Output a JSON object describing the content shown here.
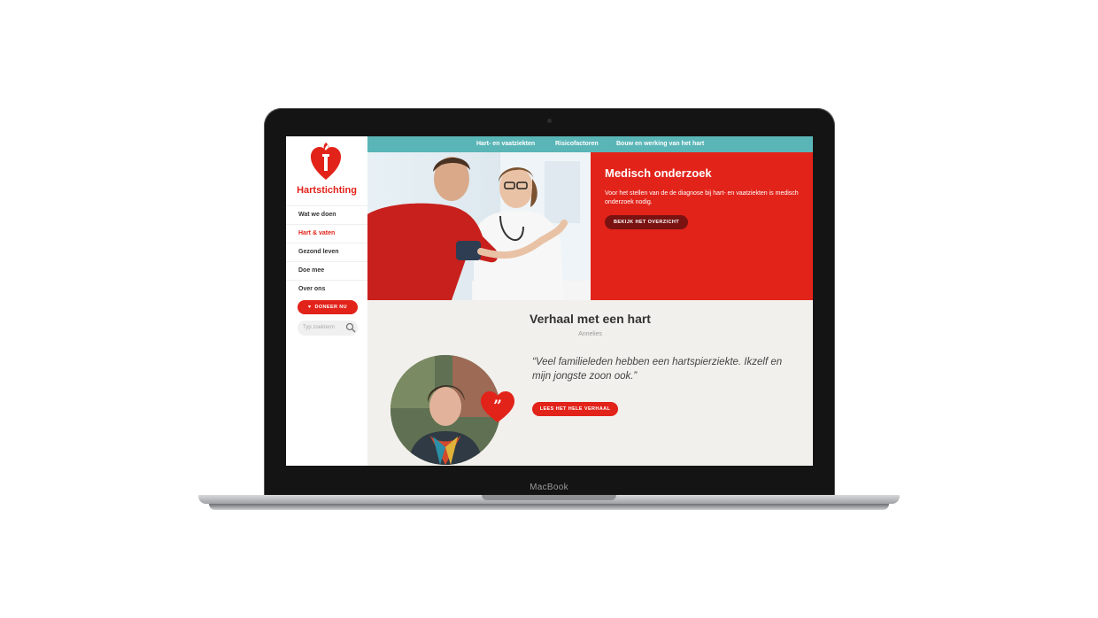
{
  "device": {
    "brand_label": "MacBook"
  },
  "sidebar": {
    "logo_text": "Hartstichting",
    "items": [
      {
        "label": "Wat we doen",
        "active": false
      },
      {
        "label": "Hart & vaten",
        "active": true
      },
      {
        "label": "Gezond leven",
        "active": false
      },
      {
        "label": "Doe mee",
        "active": false
      },
      {
        "label": "Over ons",
        "active": false
      }
    ],
    "donate_label": "DONEER NU",
    "search_placeholder": "Typ zoekterm"
  },
  "topnav": {
    "items": [
      "Hart- en vaatziekten",
      "Risicofactoren",
      "Bouw en werking van het hart"
    ]
  },
  "hero": {
    "title": "Medisch onderzoek",
    "text": "Voor het stellen van de de diagnose bij hart- en vaatziekten is medisch onderzoek nodig.",
    "button_label": "BEKIJK HET OVERZICHT"
  },
  "story": {
    "title": "Verhaal met een hart",
    "name": "Annelies",
    "quote": "“Veel familieleden hebben een hartspierziekte. Ikzelf en mijn jongste zoon ook.”",
    "button_label": "LEES HET HELE VERHAAL"
  },
  "colors": {
    "brand_red": "#e2231a",
    "teal": "#5ab5b7",
    "dark_red": "#7a1212",
    "story_bg": "#f2f0ec"
  }
}
